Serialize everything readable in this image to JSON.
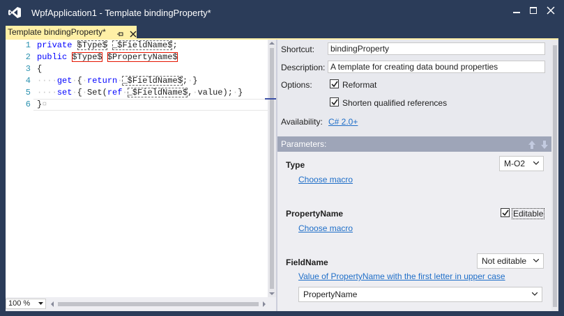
{
  "window": {
    "title": "WpfApplication1 - Template bindingProperty*",
    "controls": [
      "minimize-icon",
      "maximize-icon",
      "close-icon"
    ]
  },
  "tab": {
    "label": "Template bindingProperty*",
    "pin_glyph": "pin-icon",
    "close_glyph": "close-icon"
  },
  "editor": {
    "lines": [
      {
        "num": "1",
        "parts": [
          {
            "t": "private",
            "c": "kw"
          },
          {
            "t": " ",
            "c": "ws"
          },
          {
            "t": "$Type$",
            "c": "ph-dot"
          },
          {
            "t": " ",
            "c": "ws"
          },
          {
            "t": "_$FieldName$",
            "c": "ph-dot"
          },
          {
            "t": ";",
            "c": ""
          }
        ]
      },
      {
        "num": "2",
        "parts": [
          {
            "t": "public",
            "c": "kw"
          },
          {
            "t": " ",
            "c": "ws"
          },
          {
            "t": "$Type$",
            "c": "ph-red"
          },
          {
            "t": " ",
            "c": "ws"
          },
          {
            "t": "$PropertyName$",
            "c": "ph-red"
          }
        ]
      },
      {
        "num": "3",
        "parts": [
          {
            "t": "{",
            "c": ""
          }
        ]
      },
      {
        "num": "4",
        "parts": [
          {
            "t": "····",
            "c": "ws"
          },
          {
            "t": "get",
            "c": "kw"
          },
          {
            "t": "·",
            "c": "ws"
          },
          {
            "t": "{",
            "c": ""
          },
          {
            "t": "·",
            "c": "ws"
          },
          {
            "t": "return",
            "c": "kw"
          },
          {
            "t": "·",
            "c": "ws"
          },
          {
            "t": "_$FieldName$",
            "c": "ph-dot"
          },
          {
            "t": ";",
            "c": ""
          },
          {
            "t": "·",
            "c": "ws"
          },
          {
            "t": "}",
            "c": ""
          }
        ]
      },
      {
        "num": "5",
        "parts": [
          {
            "t": "····",
            "c": "ws"
          },
          {
            "t": "set",
            "c": "kw"
          },
          {
            "t": "·",
            "c": "ws"
          },
          {
            "t": "{",
            "c": ""
          },
          {
            "t": "·",
            "c": "ws"
          },
          {
            "t": "Set(",
            "c": ""
          },
          {
            "t": "ref",
            "c": "kw"
          },
          {
            "t": "·",
            "c": "ws"
          },
          {
            "t": "_$FieldName$",
            "c": "ph-dot"
          },
          {
            "t": ",",
            "c": ""
          },
          {
            "t": "·",
            "c": "ws"
          },
          {
            "t": "value);",
            "c": ""
          },
          {
            "t": "·",
            "c": "ws"
          },
          {
            "t": "}",
            "c": ""
          }
        ]
      },
      {
        "num": "6",
        "parts": [
          {
            "t": "}",
            "c": ""
          },
          {
            "t": "¤",
            "c": "ws"
          }
        ]
      }
    ],
    "zoom": "100 %"
  },
  "panel": {
    "shortcut_label": "Shortcut:",
    "shortcut_value": "bindingProperty",
    "description_label": "Description:",
    "description_value": "A template for creating data bound properties",
    "options_label": "Options:",
    "reformat_label": "Reformat",
    "reformat_checked": true,
    "shorten_label": "Shorten qualified references",
    "shorten_checked": true,
    "availability_label": "Availability:",
    "availability_link": "C# 2.0+",
    "parameters_header": "Parameters:",
    "params": {
      "type_name": "Type",
      "type_macro": "Choose macro",
      "type_dropdown": "M-O2",
      "prop_name": "PropertyName",
      "prop_macro": "Choose macro",
      "prop_editable_label": "Editable",
      "prop_editable_checked": true,
      "field_name": "FieldName",
      "field_dropdown": "Not editable",
      "field_macro": "Value of PropertyName with the first letter in upper case",
      "field_source": "PropertyName"
    }
  },
  "colors": {
    "titlebar": "#2b3c59",
    "tab_active": "#fff0a6",
    "link": "#1e6ec8",
    "params_header": "#9ea5b8",
    "keyword": "#0000ff",
    "line_number": "#2b91af",
    "placeholder_error": "#e51400"
  }
}
